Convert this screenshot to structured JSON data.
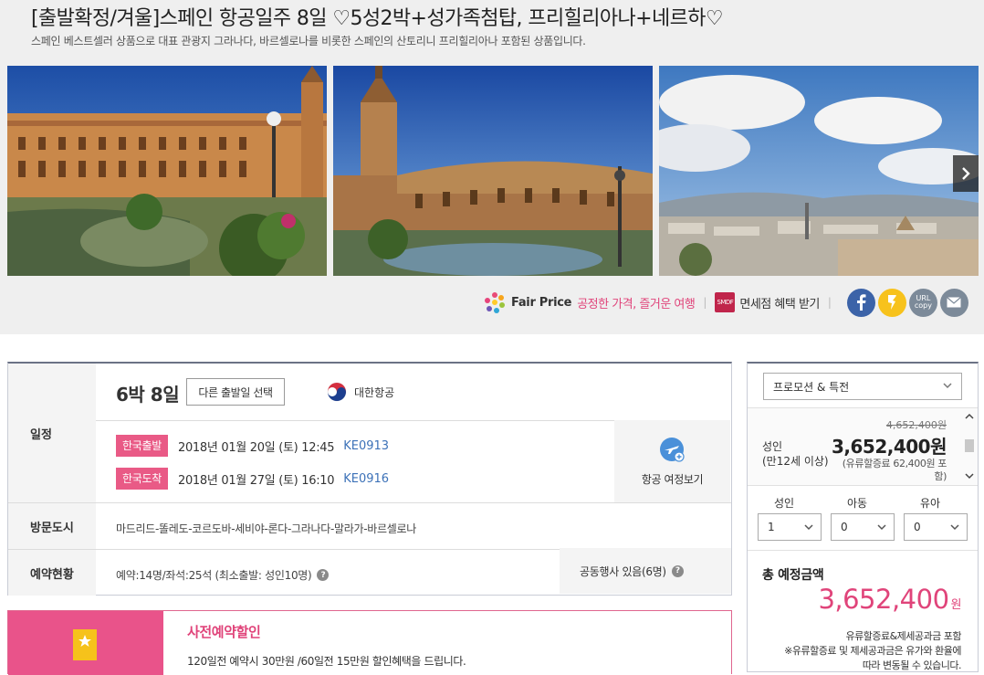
{
  "header": {
    "title": "[출발확정/겨울]스페인 항공일주 8일 ♡5성2박+성가족첨탑, 프리힐리아나+네르하♡",
    "subtitle": "스페인 베스트셀러 상품으로 대표 관광지 그라나다, 바르셀로나를 비롯한 스페인의 산토리니 프리힐리아나 포함된 상품입니다."
  },
  "share": {
    "fair_price": "Fair Price",
    "fair_slogan": "공정한 가격, 즐거운 여행",
    "duty_free_icon_text": "SMDF",
    "duty_free": "면세점 혜택 받기",
    "url_copy_line1": "URL",
    "url_copy_line2": "copy"
  },
  "itinerary": {
    "label": "일정",
    "nights": "6박 8일",
    "change_date_btn": "다른 출발일 선택",
    "airline": "대한항공",
    "departure": {
      "tag": "한국출발",
      "datetime": "2018년 01월 20일 (토) 12:45",
      "flight": "KE0913"
    },
    "arrival": {
      "tag": "한국도착",
      "datetime": "2018년 01월 27일 (토) 16:10",
      "flight": "KE0916"
    },
    "flight_view": "항공 여정보기"
  },
  "cities": {
    "label": "방문도시",
    "value": "마드리드-똘레도-코르도바-세비야-론다-그라나다-말라가-바르셀로나"
  },
  "reservation": {
    "label": "예약현황",
    "value": "예약:14명/좌석:25석 (최소출발: 성인10명)",
    "joint": "공동행사 있음(6명)"
  },
  "promo": {
    "title": "사전예약할인",
    "desc": "120일전 예약시 30만원 /60일전 15만원 할인혜택을 드립니다."
  },
  "sidebar": {
    "promo_select": "프로모션 & 특전",
    "adult_label": "성인",
    "adult_sub": "(만12세 이상)",
    "old_price": "4,652,400원",
    "new_price": "3,652,400원",
    "fuel_note": "(유류할증료 62,400원 포함)",
    "pax": [
      {
        "label": "성인",
        "value": "1"
      },
      {
        "label": "아동",
        "value": "0"
      },
      {
        "label": "유아",
        "value": "0"
      }
    ],
    "total_label": "총 예정금액",
    "total_price": "3,652,400",
    "total_unit": "원",
    "total_note_1": "유류할증료&제세공과금 포함",
    "total_note_2": "※유류할증료 및 제세공과금은 유가와 환율에",
    "total_note_3": "따라 변동될 수 있습니다."
  },
  "colors": {
    "accent_pink": "#e0447a",
    "tag_pink": "#e95a86",
    "link_blue": "#3d72b8",
    "facebook": "#3c63a8",
    "kakao": "#f7c21c"
  }
}
